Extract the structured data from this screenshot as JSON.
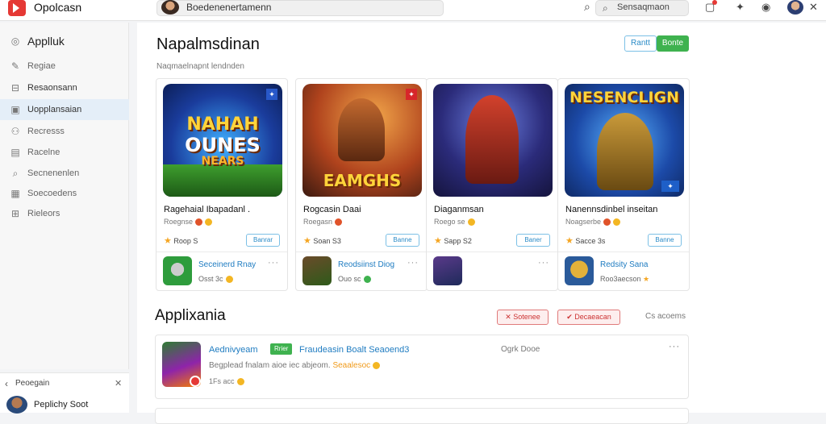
{
  "app": {
    "title": "Opolcasn"
  },
  "topbar": {
    "address_text": "Boedenenertamenn",
    "search_placeholder": "Sensaqmaon"
  },
  "sidebar": {
    "header": "Applluk",
    "items": [
      {
        "label": "Regiae",
        "icon": "pencil-icon"
      },
      {
        "label": "Resaonsann",
        "icon": "square-icon"
      },
      {
        "label": "Uopplansaian",
        "icon": "monitor-icon",
        "active": true
      },
      {
        "label": "Recresss",
        "icon": "users-icon"
      },
      {
        "label": "Racelne",
        "icon": "document-icon"
      },
      {
        "label": "Secnenenlen",
        "icon": "search-icon"
      },
      {
        "label": "Soecoedens",
        "icon": "grid-icon"
      },
      {
        "label": "Rieleors",
        "icon": "table-icon"
      }
    ]
  },
  "side_footer": {
    "title": "Peoegain",
    "user_name": "Peplichy Soot"
  },
  "main": {
    "heading": "Napalmsdinan",
    "subheading": "Naqmaelnapnt lendnden",
    "btn_outline": "Rantt",
    "btn_green": "Bonte",
    "cards": [
      {
        "image_text": [
          "NAHAH",
          "OUNES",
          "NEARS"
        ],
        "name": "Ragehaial Ibapadanl .",
        "meta": "Roegnse",
        "rating": "Roop S",
        "button": "Banrar",
        "mini_name": "Seceinerd Rnay",
        "mini_meta": "Osst 3c"
      },
      {
        "image_text": [
          "EAMGHS"
        ],
        "name": "Rogcasin Daai",
        "meta": "Roegasn",
        "rating": "Soan S3",
        "button": "Banne",
        "mini_name": "Reodsiinst Diog",
        "mini_meta": "Ouo sc"
      },
      {
        "image_text": [],
        "name": "Diaganmsan",
        "meta": "Roego se",
        "rating": "Sapp S2",
        "button": "Baner",
        "mini_name": "",
        "mini_meta": ""
      },
      {
        "image_text": [
          "NESENCLIGN"
        ],
        "name": "Nanennsdinbel inseitan",
        "meta": "Noagserbe",
        "rating": "Sacce 3s",
        "button": "Banne",
        "mini_name": "Redsity Sana",
        "mini_meta": "Roo3aecson"
      }
    ],
    "section_title": "Applixania",
    "filter_1": "Sotenee",
    "filter_2": "Decaeacan",
    "sort_label": "Cs acoems",
    "list_item": {
      "name": "Aednivyeam",
      "tag": "Rrier",
      "publisher": "Fraudeasin Boalt  Seaoend3",
      "right_text": "Ogrk Dooe",
      "desc_start": "Begplead fnalam aioe iec abjeom.",
      "desc_highlight": "Seaalesoc",
      "stat": "1Fs acc"
    }
  }
}
